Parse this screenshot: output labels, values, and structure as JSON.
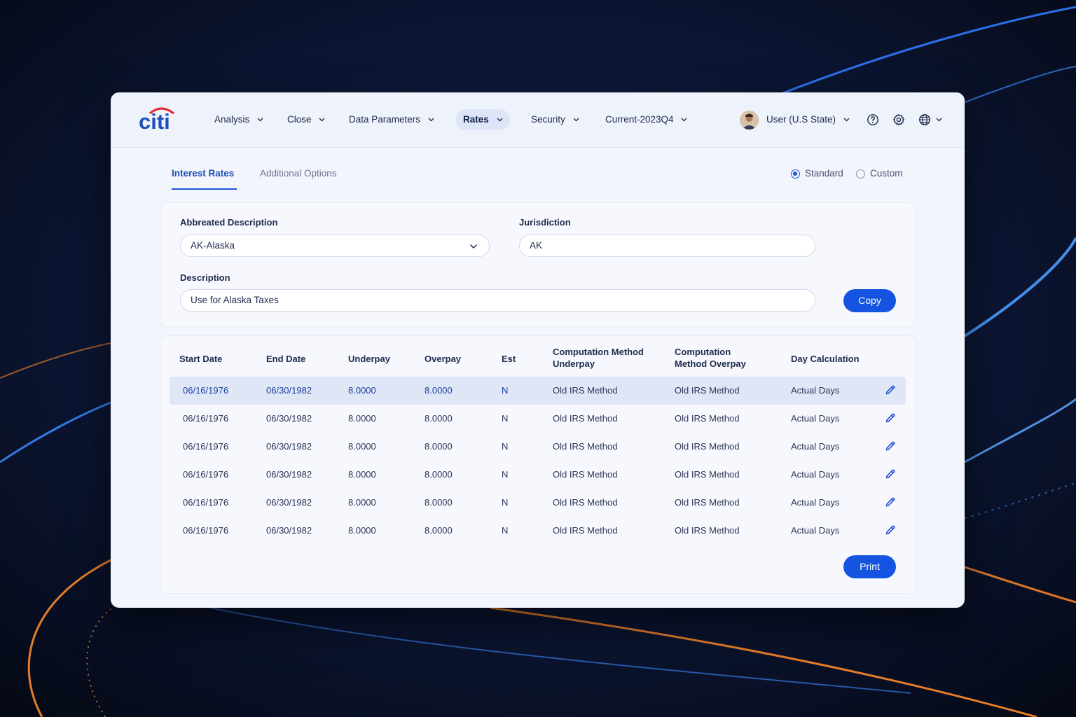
{
  "colors": {
    "accent": "#1454e0",
    "brand_blue": "#1f4fb8",
    "brand_red": "#e3262f",
    "selected_row": "#dfe7f7"
  },
  "header": {
    "logo_text": "citi",
    "nav": [
      {
        "label": "Analysis",
        "active": false
      },
      {
        "label": "Close",
        "active": false
      },
      {
        "label": "Data Parameters",
        "active": false
      },
      {
        "label": "Rates",
        "active": true
      },
      {
        "label": "Security",
        "active": false
      },
      {
        "label": "Current-2023Q4",
        "active": false
      }
    ],
    "user_label": "User (U.S State)",
    "icons": [
      "help-circle-icon",
      "gear-icon",
      "globe-icon"
    ]
  },
  "tabs": [
    {
      "label": "Interest Rates",
      "active": true
    },
    {
      "label": "Additional Options",
      "active": false
    }
  ],
  "mode": {
    "options": [
      "Standard",
      "Custom"
    ],
    "selected": "Standard"
  },
  "form": {
    "abbreviated_label": "Abbreated Description",
    "abbreviated_value": "AK-Alaska",
    "jurisdiction_label": "Jurisdiction",
    "jurisdiction_value": "AK",
    "description_label": "Description",
    "description_value": "Use for Alaska Taxes",
    "copy_label": "Copy"
  },
  "table": {
    "columns": [
      "Start Date",
      "End Date",
      "Underpay",
      "Overpay",
      "Est",
      "Computation Method Underpay",
      "Computation Method Overpay",
      "Day Calculation"
    ],
    "rows": [
      {
        "start": "06/16/1976",
        "end": "06/30/1982",
        "underpay": "8.0000",
        "overpay": "8.0000",
        "est": "N",
        "method_under": "Old IRS Method",
        "method_over": "Old IRS Method",
        "day_calc": "Actual Days",
        "selected": true
      },
      {
        "start": "06/16/1976",
        "end": "06/30/1982",
        "underpay": "8.0000",
        "overpay": "8.0000",
        "est": "N",
        "method_under": "Old IRS Method",
        "method_over": "Old IRS Method",
        "day_calc": "Actual Days",
        "selected": false
      },
      {
        "start": "06/16/1976",
        "end": "06/30/1982",
        "underpay": "8.0000",
        "overpay": "8.0000",
        "est": "N",
        "method_under": "Old IRS Method",
        "method_over": "Old IRS Method",
        "day_calc": "Actual Days",
        "selected": false
      },
      {
        "start": "06/16/1976",
        "end": "06/30/1982",
        "underpay": "8.0000",
        "overpay": "8.0000",
        "est": "N",
        "method_under": "Old IRS Method",
        "method_over": "Old IRS Method",
        "day_calc": "Actual Days",
        "selected": false
      },
      {
        "start": "06/16/1976",
        "end": "06/30/1982",
        "underpay": "8.0000",
        "overpay": "8.0000",
        "est": "N",
        "method_under": "Old IRS Method",
        "method_over": "Old IRS Method",
        "day_calc": "Actual Days",
        "selected": false
      },
      {
        "start": "06/16/1976",
        "end": "06/30/1982",
        "underpay": "8.0000",
        "overpay": "8.0000",
        "est": "N",
        "method_under": "Old IRS Method",
        "method_over": "Old IRS Method",
        "day_calc": "Actual Days",
        "selected": false
      }
    ],
    "print_label": "Print"
  }
}
